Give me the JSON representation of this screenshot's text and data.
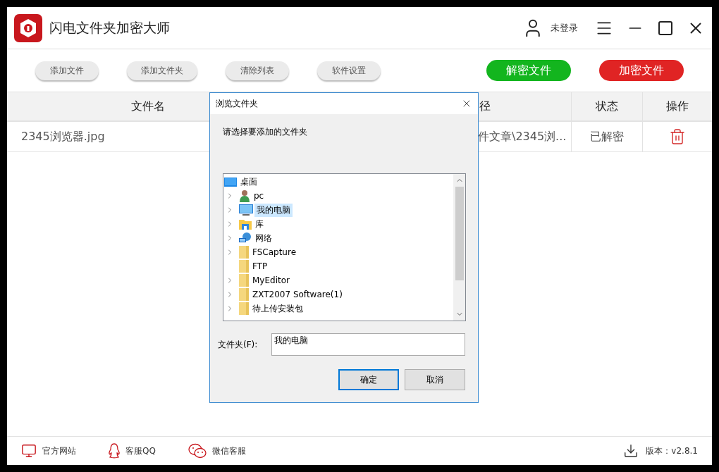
{
  "app": {
    "title": "闪电文件夹加密大师",
    "user": "未登录"
  },
  "toolbar": [
    {
      "label": "添加文件",
      "kind": "plain"
    },
    {
      "label": "添加文件夹",
      "kind": "plain"
    },
    {
      "label": "清除列表",
      "kind": "plain"
    },
    {
      "label": "软件设置",
      "kind": "plain"
    },
    {
      "label": "解密文件",
      "kind": "decrypt"
    },
    {
      "label": "加密文件",
      "kind": "encrypt"
    }
  ],
  "table": {
    "columns": [
      "文件名",
      "径",
      "状态",
      "操作"
    ],
    "rows": [
      {
        "name": "2345浏览器.jpg",
        "path": "件文章\\2345浏...",
        "status": "已解密"
      }
    ]
  },
  "dialog": {
    "title": "浏览文件夹",
    "prompt": "请选择要添加的文件夹",
    "tree": {
      "label": "桌面",
      "kind": "desktop",
      "expanded": true,
      "selected": false,
      "children": [
        {
          "label": "pc",
          "kind": "user",
          "expandable": true,
          "selected": false
        },
        {
          "label": "我的电脑",
          "kind": "computer",
          "expandable": true,
          "selected": true
        },
        {
          "label": "库",
          "kind": "library",
          "expandable": true,
          "selected": false
        },
        {
          "label": "网络",
          "kind": "network",
          "expandable": true,
          "selected": false
        },
        {
          "label": "FSCapture",
          "kind": "folder",
          "expandable": true,
          "selected": false
        },
        {
          "label": "FTP",
          "kind": "folder",
          "expandable": false,
          "selected": false
        },
        {
          "label": "MyEditor",
          "kind": "folder",
          "expandable": true,
          "selected": false
        },
        {
          "label": "ZXT2007 Software(1)",
          "kind": "folder",
          "expandable": true,
          "selected": false
        },
        {
          "label": "待上传安装包",
          "kind": "folder",
          "expandable": true,
          "selected": false
        }
      ]
    },
    "folder_label": "文件夹(F):",
    "folder_value": "我的电脑",
    "buttons": [
      {
        "label": "确定",
        "default": true
      },
      {
        "label": "取消",
        "default": false
      }
    ]
  },
  "footer": {
    "links": [
      {
        "label": "官方网站",
        "kind": "website"
      },
      {
        "label": "客服QQ",
        "kind": "qq"
      },
      {
        "label": "微信客服",
        "kind": "wechat"
      }
    ],
    "version": "版本：v2.8.1"
  }
}
